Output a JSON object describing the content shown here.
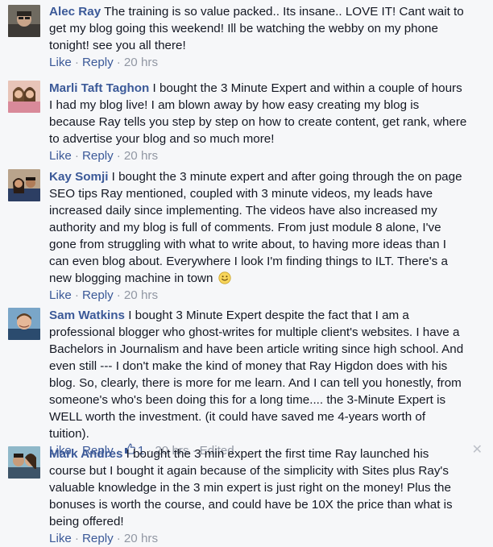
{
  "comments": [
    {
      "author": "Alec Ray",
      "text": "The training is so value packed.. Its insane.. LOVE IT! Cant wait to get my blog going this weekend! Ill be watching the webby on my phone tonight! see you all there!",
      "like": "Like",
      "reply": "Reply",
      "time": "20 hrs"
    },
    {
      "author": "Marli Taft Taghon",
      "text": "I bought the 3 Minute Expert and within a couple of hours I had my blog live! I am blown away by how easy creating my blog is because Ray tells you step by step on how to create content, get rank, where to advertise your blog and so much more!",
      "like": "Like",
      "reply": "Reply",
      "time": "20 hrs"
    },
    {
      "author": "Kay Somji",
      "text": "I bought the 3 minute expert and after going through the on page SEO tips Ray mentioned, coupled with 3 minute videos, my leads have increased daily since implementing. The videos have also increased my authority and my blog is full of comments. From just module 8 alone, I've gone from struggling with what to write about, to having more ideas than I can even blog about. Everywhere I look I'm finding things to ILT. There's a new blogging machine in town",
      "like": "Like",
      "reply": "Reply",
      "time": "20 hrs",
      "emoji": "smiley-icon"
    },
    {
      "author": "Sam Watkins",
      "text": "I bought 3 Minute Expert despite the fact that I am a professional blogger who ghost-writes for multiple client's websites. I have a Bachelors in Journalism and have been article writing since high school. And even still --- I don't make the kind of money that Ray Higdon does with his blog. So, clearly, there is more for me learn. And I can tell you honestly, from someone's who's been doing this for a long time.... the 3-Minute Expert is WELL worth the investment. (it could have saved me 4-years worth of tuition).",
      "like": "Like",
      "reply": "Reply",
      "like_count": "1",
      "time": "20 hrs",
      "edited": "Edited"
    },
    {
      "author": "Mark Andres",
      "text": "I bought the 3 min expert the first time Ray launched his course but I bought it again because of the simplicity with Sites plus Ray's valuable knowledge in the 3 min expert is just right on the money! Plus the bonuses is worth the course, and could have be 10X the price than what is being offered!",
      "like": "Like",
      "reply": "Reply",
      "time": "20 hrs",
      "close": "✕"
    }
  ],
  "separator": "·",
  "colors": {
    "link": "#3b5998",
    "meta": "#9197a3",
    "background": "#f6f7f9"
  }
}
